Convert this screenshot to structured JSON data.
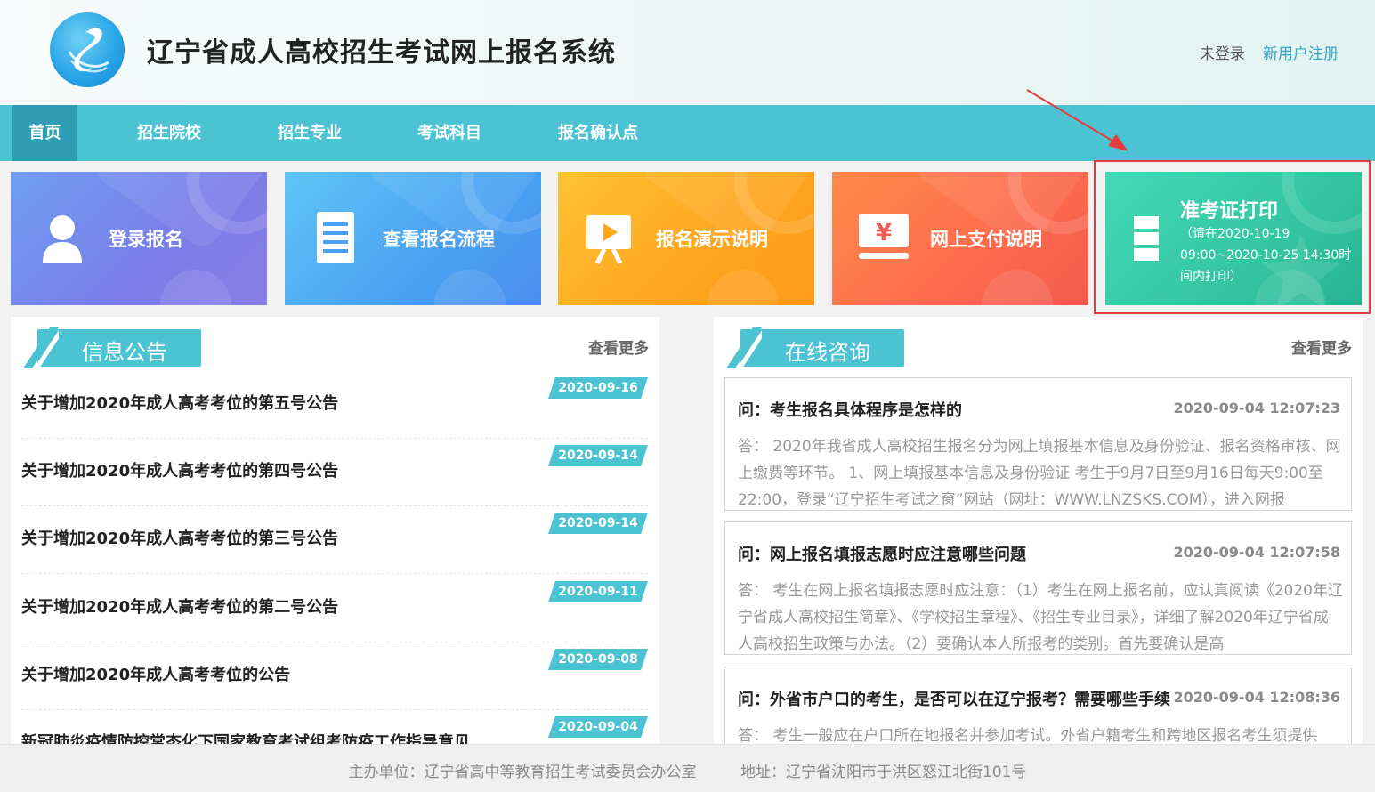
{
  "header": {
    "site_title": "辽宁省成人高校招生考试网上报名系统",
    "login_status": "未登录",
    "register_label": "新用户注册"
  },
  "nav": {
    "items": [
      {
        "label": "首页",
        "active": true
      },
      {
        "label": "招生院校",
        "active": false
      },
      {
        "label": "招生专业",
        "active": false
      },
      {
        "label": "考试科目",
        "active": false
      },
      {
        "label": "报名确认点",
        "active": false
      }
    ]
  },
  "tiles": [
    {
      "label": "登录报名",
      "icon": "user-icon",
      "color": "#7b7de8"
    },
    {
      "label": "查看报名流程",
      "icon": "document-icon",
      "color": "#4aa2f2"
    },
    {
      "label": "报名演示说明",
      "icon": "video-play-icon",
      "color": "#ffa51f"
    },
    {
      "label": "网上支付说明",
      "icon": "yen-payment-icon",
      "color": "#fd6b4e"
    },
    {
      "label": "准考证打印",
      "icon": "print-icon",
      "color": "#34c6a3",
      "note": "（请在2020-10-19 09:00~2020-10-25 14:30时间内打印）"
    }
  ],
  "notices": {
    "title": "信息公告",
    "more_label": "查看更多",
    "items": [
      {
        "title": "关于增加2020年成人高考考位的第五号公告",
        "date": "2020-09-16"
      },
      {
        "title": "关于增加2020年成人高考考位的第四号公告",
        "date": "2020-09-14"
      },
      {
        "title": "关于增加2020年成人高考考位的第三号公告",
        "date": "2020-09-14"
      },
      {
        "title": "关于增加2020年成人高考考位的第二号公告",
        "date": "2020-09-11"
      },
      {
        "title": "关于增加2020年成人高考考位的公告",
        "date": "2020-09-08"
      },
      {
        "title": "新冠肺炎疫情防控常态化下国家教育考试组考防疫工作指导意见",
        "date": "2020-09-04"
      }
    ]
  },
  "consult": {
    "title": "在线咨询",
    "more_label": "查看更多",
    "items": [
      {
        "question": "问：考生报名具体程序是怎样的",
        "time": "2020-09-04 12:07:23",
        "answer": "答： 2020年我省成人高校招生报名分为网上填报基本信息及身份验证、报名资格审核、网上缴费等环节。 1、网上填报基本信息及身份验证 考生于9月7日至9月16日每天9:00至22:00，登录“辽宁招生考试之窗”网站（网址：WWW.LNZSKS.COM），进入网报"
      },
      {
        "question": "问：网上报名填报志愿时应注意哪些问题",
        "time": "2020-09-04 12:07:58",
        "answer": "答： 考生在网上报名填报志愿时应注意：（1）考生在网上报名前，应认真阅读《2020年辽宁省成人高校招生简章》、《学校招生章程》、《招生专业目录》，详细了解2020年辽宁省成人高校招生政策与办法。（2）要确认本人所报考的类别。首先要确认是高"
      },
      {
        "question": "问：外省市户口的考生，是否可以在辽宁报考？需要哪些手续",
        "time": "2020-09-04 12:08:36",
        "answer": "答： 考生一般应在户口所在地报名并参加考试。外省户籍考生和跨地区报名考生须提供"
      }
    ]
  },
  "footer": {
    "organizer": "主办单位：辽宁省高中等教育招生考试委员会办公室",
    "address": "地址：辽宁省沈阳市于洪区怒江北街101号"
  },
  "colors": {
    "nav_bg": "#4cc3d3",
    "nav_active": "#2f9db3",
    "highlight": "#e83b3b"
  }
}
